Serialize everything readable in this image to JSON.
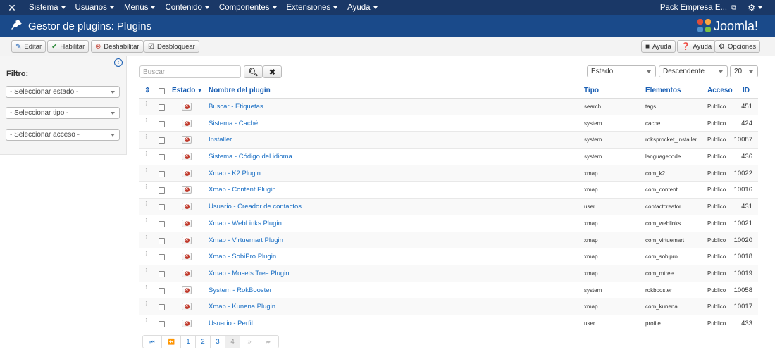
{
  "navbar": {
    "items": [
      "Sistema",
      "Usuarios",
      "Menús",
      "Contenido",
      "Componentes",
      "Extensiones",
      "Ayuda"
    ],
    "site_name": "Pack Empresa E..."
  },
  "header": {
    "title": "Gestor de plugins: Plugins",
    "logo_text": "Joomla!"
  },
  "toolbar": {
    "edit": "Editar",
    "enable": "Habilitar",
    "disable": "Deshabilitar",
    "unlock": "Desbloquear",
    "video_help": "Ayuda",
    "help": "Ayuda",
    "options": "Opciones"
  },
  "sidebar": {
    "filter_label": "Filtro:",
    "select_state": "- Seleccionar estado -",
    "select_type": "- Seleccionar tipo -",
    "select_access": "- Seleccionar acceso -"
  },
  "search": {
    "placeholder": "Buscar"
  },
  "sorting": {
    "field": "Estado",
    "direction": "Descendente",
    "limit": "20"
  },
  "table": {
    "headers": {
      "status": "Estado",
      "name": "Nombre del plugin",
      "type": "Tipo",
      "element": "Elementos",
      "access": "Acceso",
      "id": "ID"
    },
    "rows": [
      {
        "name": "Buscar - Etiquetas",
        "type": "search",
        "element": "tags",
        "access": "Publico",
        "id": "451"
      },
      {
        "name": "Sistema - Caché",
        "type": "system",
        "element": "cache",
        "access": "Publico",
        "id": "424"
      },
      {
        "name": "Installer",
        "type": "system",
        "element": "roksprocket_installer",
        "access": "Publico",
        "id": "10087"
      },
      {
        "name": "Sistema - Código del idioma",
        "type": "system",
        "element": "languagecode",
        "access": "Publico",
        "id": "436"
      },
      {
        "name": "Xmap - K2 Plugin",
        "type": "xmap",
        "element": "com_k2",
        "access": "Publico",
        "id": "10022"
      },
      {
        "name": "Xmap - Content Plugin",
        "type": "xmap",
        "element": "com_content",
        "access": "Publico",
        "id": "10016"
      },
      {
        "name": "Usuario - Creador de contactos",
        "type": "user",
        "element": "contactcreator",
        "access": "Publico",
        "id": "431"
      },
      {
        "name": "Xmap - WebLinks Plugin",
        "type": "xmap",
        "element": "com_weblinks",
        "access": "Publico",
        "id": "10021"
      },
      {
        "name": "Xmap - Virtuemart Plugin",
        "type": "xmap",
        "element": "com_virtuemart",
        "access": "Publico",
        "id": "10020"
      },
      {
        "name": "Xmap - SobiPro Plugin",
        "type": "xmap",
        "element": "com_sobipro",
        "access": "Publico",
        "id": "10018"
      },
      {
        "name": "Xmap - Mosets Tree Plugin",
        "type": "xmap",
        "element": "com_mtree",
        "access": "Publico",
        "id": "10019"
      },
      {
        "name": "System - RokBooster",
        "type": "system",
        "element": "rokbooster",
        "access": "Publico",
        "id": "10058"
      },
      {
        "name": "Xmap - Kunena Plugin",
        "type": "xmap",
        "element": "com_kunena",
        "access": "Publico",
        "id": "10017"
      },
      {
        "name": "Usuario - Perfil",
        "type": "user",
        "element": "profile",
        "access": "Publico",
        "id": "433"
      }
    ]
  },
  "pagination": {
    "first": "⏮",
    "prev": "⏪",
    "pages": [
      "1",
      "2",
      "3",
      "4"
    ],
    "next": "»",
    "last": "⏭"
  },
  "colors": {
    "navbar": "#1a3867",
    "header": "#1a4a8a",
    "link": "#1a6fc4",
    "status_disabled": "#c0392b"
  }
}
